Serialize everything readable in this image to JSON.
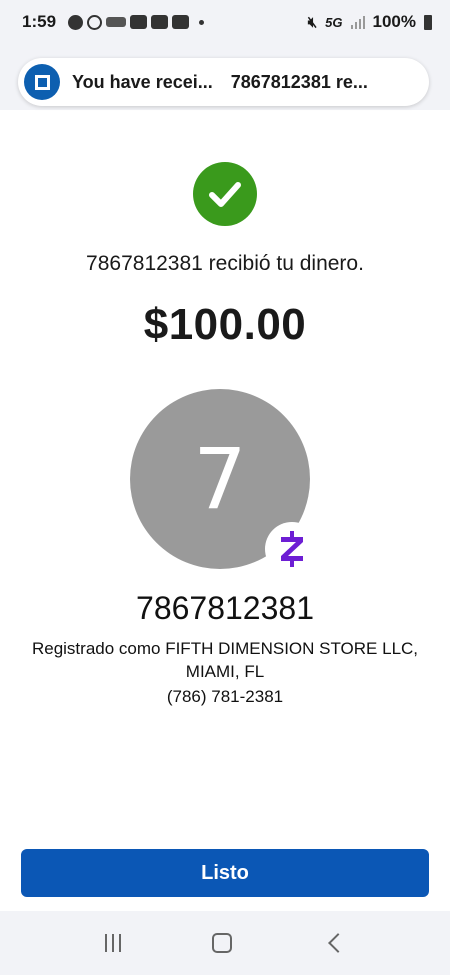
{
  "status_bar": {
    "time": "1:59",
    "network": "5G",
    "battery": "100%"
  },
  "notification": {
    "title": "You have recei...",
    "body": "7867812381 re..."
  },
  "confirmation": {
    "message": "7867812381 recibió tu dinero.",
    "amount": "$100.00"
  },
  "recipient": {
    "initial": "7",
    "badge": "Z",
    "name": "7867812381",
    "registered_line1": "Registrado como FIFTH DIMENSION STORE LLC,",
    "registered_line2": "MIAMI, FL",
    "phone": "(786) 781-2381"
  },
  "actions": {
    "done_label": "Listo"
  },
  "colors": {
    "primary_button": "#0b57b5",
    "success": "#3a9a1c",
    "zelle_purple": "#6d1ed4",
    "avatar_gray": "#9a9a9a"
  }
}
